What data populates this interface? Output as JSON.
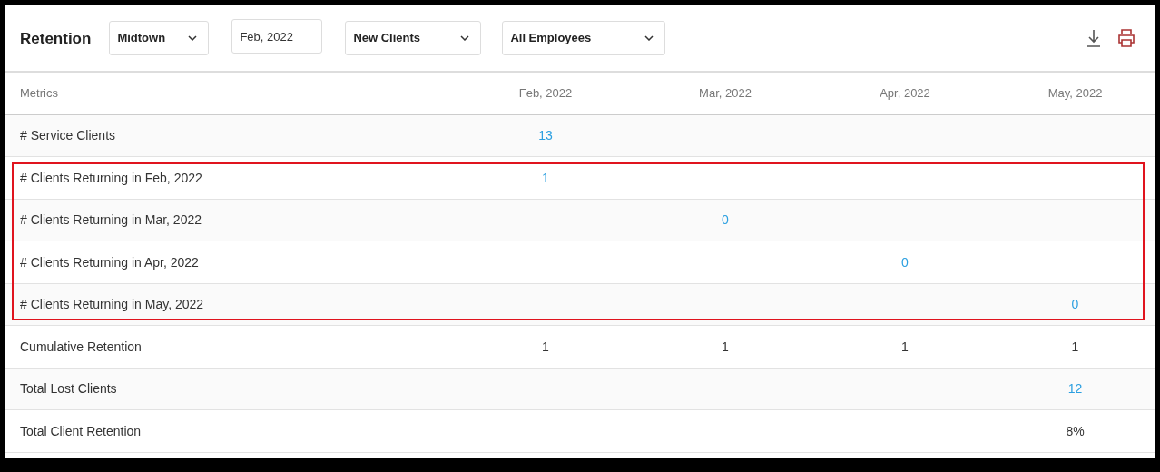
{
  "toolbar": {
    "title": "Retention",
    "filters": [
      {
        "kind": "select",
        "value": "Midtown"
      },
      {
        "kind": "date",
        "value": "Feb, 2022"
      },
      {
        "kind": "select",
        "value": "New Clients"
      },
      {
        "kind": "select",
        "value": "All Employees"
      }
    ]
  },
  "table": {
    "columns": [
      "Metrics",
      "Feb, 2022",
      "Mar, 2022",
      "Apr, 2022",
      "May, 2022"
    ],
    "rows": [
      {
        "highlighted": false,
        "kind": "link",
        "cells": [
          "# Service Clients",
          "13",
          "",
          "",
          ""
        ]
      },
      {
        "highlighted": true,
        "kind": "link",
        "cells": [
          "# Clients Returning in Feb, 2022",
          "1",
          "",
          "",
          ""
        ]
      },
      {
        "highlighted": true,
        "kind": "link",
        "cells": [
          "# Clients Returning in Mar, 2022",
          "",
          "0",
          "",
          ""
        ]
      },
      {
        "highlighted": true,
        "kind": "link",
        "cells": [
          "# Clients Returning in Apr, 2022",
          "",
          "",
          "0",
          ""
        ]
      },
      {
        "highlighted": true,
        "kind": "link",
        "cells": [
          "# Clients Returning in May, 2022",
          "",
          "",
          "",
          "0"
        ]
      },
      {
        "highlighted": false,
        "kind": "plain",
        "cells": [
          "Cumulative Retention",
          "1",
          "1",
          "1",
          "1"
        ]
      },
      {
        "highlighted": false,
        "kind": "link",
        "cells": [
          "Total Lost Clients",
          "",
          "",
          "",
          "12"
        ]
      },
      {
        "highlighted": false,
        "kind": "plain",
        "cells": [
          "Total Client Retention",
          "",
          "",
          "",
          "8%"
        ]
      }
    ]
  }
}
